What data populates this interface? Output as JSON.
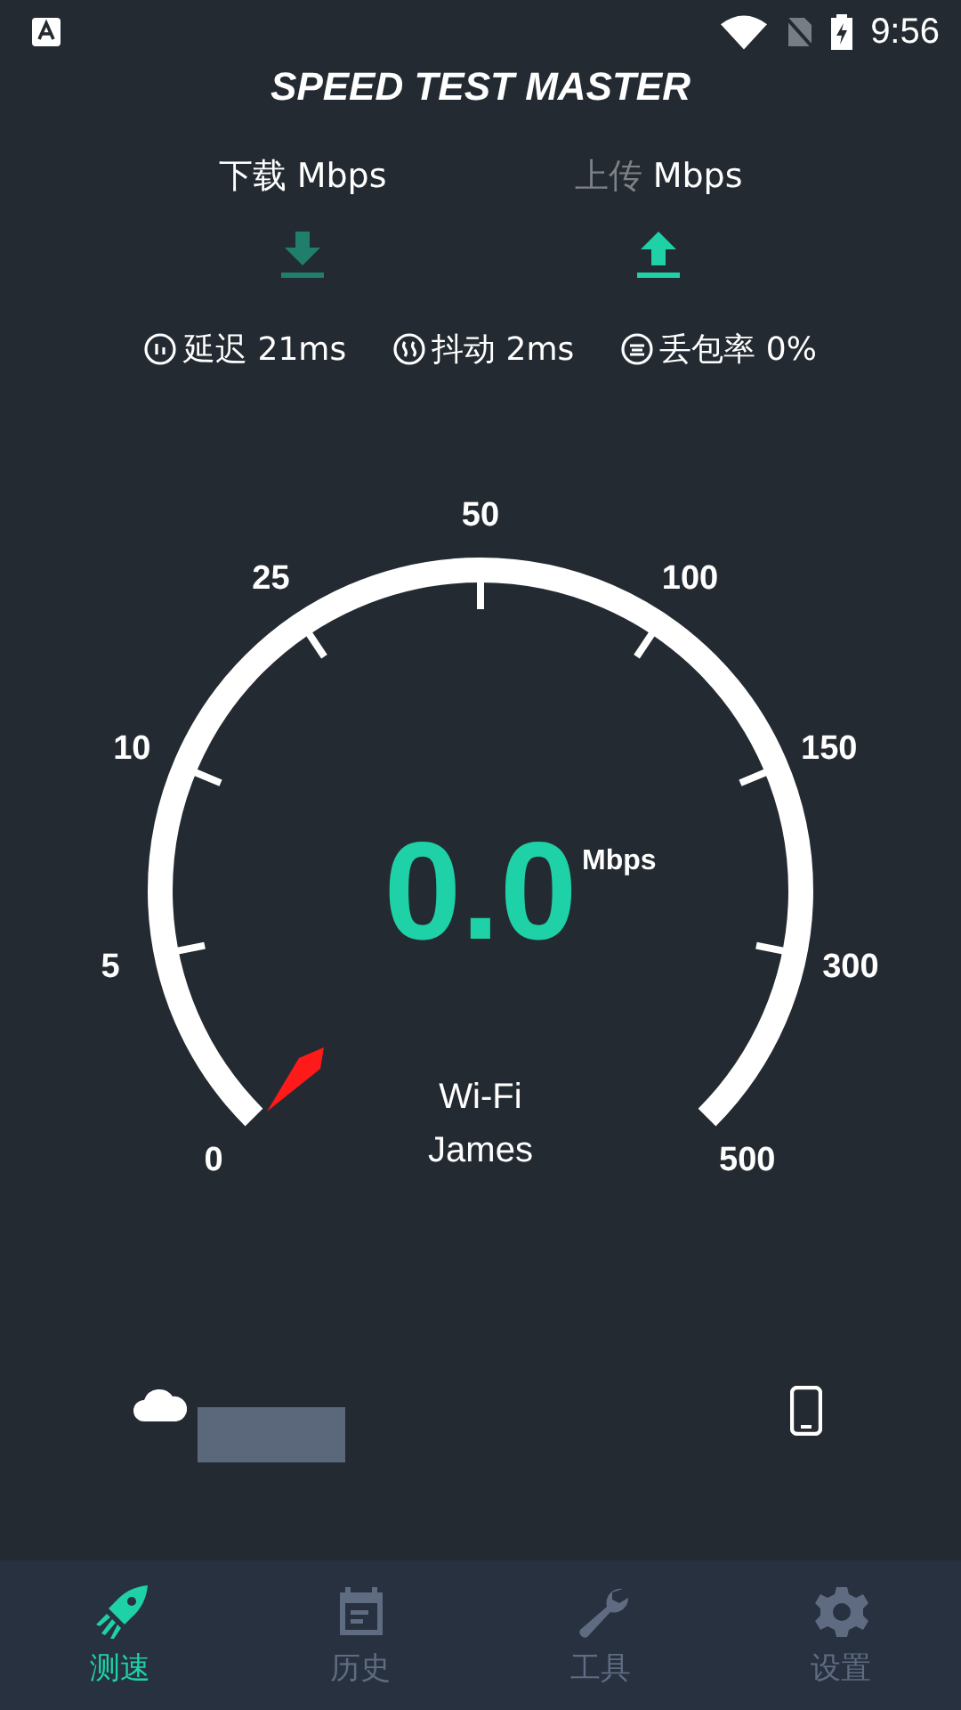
{
  "status_bar": {
    "time": "9:56"
  },
  "app_title": "SPEED TEST MASTER",
  "directions": [
    {
      "kind": "download",
      "label": "下载",
      "unit": "Mbps",
      "label_dimmed": false,
      "icon_active": false
    },
    {
      "kind": "upload",
      "label": "上传",
      "unit": "Mbps",
      "label_dimmed": true,
      "icon_active": true
    }
  ],
  "metrics": [
    {
      "kind": "latency",
      "label": "延迟",
      "value": "21ms"
    },
    {
      "kind": "jitter",
      "label": "抖动",
      "value": "2ms"
    },
    {
      "kind": "loss",
      "label": "丢包率",
      "value": "0%"
    }
  ],
  "gauge": {
    "scale": [
      "0",
      "5",
      "10",
      "25",
      "50",
      "100",
      "150",
      "300",
      "500"
    ],
    "speed": "0.0",
    "unit": "Mbps",
    "network": "Wi-Fi",
    "name": "James"
  },
  "nav": [
    {
      "kind": "speed",
      "label": "测速",
      "selected": true
    },
    {
      "kind": "history",
      "label": "历史",
      "selected": false
    },
    {
      "kind": "tools",
      "label": "工具",
      "selected": false
    },
    {
      "kind": "settings",
      "label": "设置",
      "selected": false
    }
  ]
}
